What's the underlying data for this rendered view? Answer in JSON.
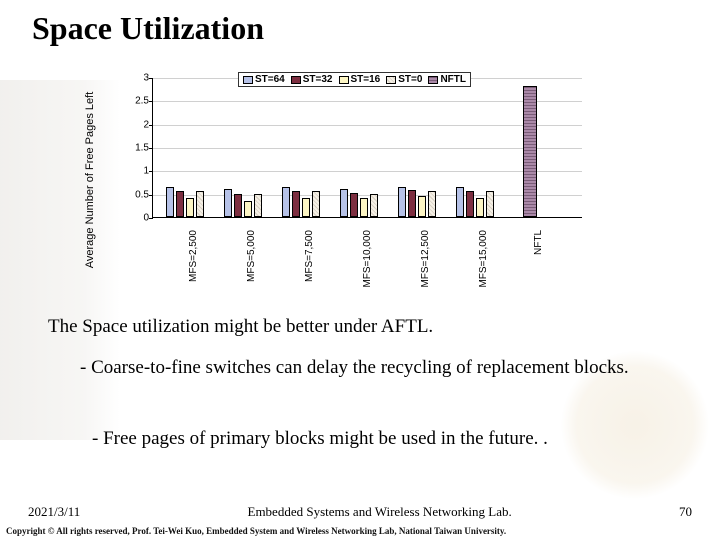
{
  "title": "Space Utilization",
  "desc1": "The Space utilization might be better under AFTL.",
  "desc2": "- Coarse-to-fine switches can delay the recycling of replacement blocks.",
  "desc3": "- Free pages of primary blocks might be used in the future. .",
  "footer": {
    "date": "2021/3/11",
    "lab": "Embedded Systems and Wireless Networking Lab.",
    "page": "70"
  },
  "copyright": "Copyright © All rights reserved, Prof. Tei-Wei Kuo, Embedded System and Wireless Networking Lab, National Taiwan University.",
  "chart_data": {
    "type": "bar",
    "ylabel": "Average Number of Free Pages Left",
    "ylim": [
      0,
      3
    ],
    "yticks": [
      0,
      0.5,
      1,
      1.5,
      2,
      2.5,
      3
    ],
    "series_names": [
      "ST=64",
      "ST=32",
      "ST=16",
      "ST=0"
    ],
    "categories": [
      "MFS=2,500",
      "MFS=5,000",
      "MFS=7,500",
      "MFS=10,000",
      "MFS=12,500",
      "MFS=15,000"
    ],
    "series": [
      {
        "name": "ST=64",
        "values": [
          0.65,
          0.6,
          0.65,
          0.6,
          0.65,
          0.65
        ]
      },
      {
        "name": "ST=32",
        "values": [
          0.55,
          0.5,
          0.55,
          0.52,
          0.58,
          0.55
        ]
      },
      {
        "name": "ST=16",
        "values": [
          0.4,
          0.35,
          0.4,
          0.4,
          0.45,
          0.4
        ]
      },
      {
        "name": "ST=0",
        "values": [
          0.55,
          0.5,
          0.55,
          0.5,
          0.55,
          0.55
        ]
      }
    ],
    "extra": {
      "name": "NFTL",
      "value": 2.8
    },
    "colors": {
      "ST=64": "#b6c2e8",
      "ST=32": "#7d2e40",
      "ST=16": "#fdf6c4",
      "ST=0": "hatch-diagonal",
      "NFTL": "hatch-horizontal"
    }
  }
}
